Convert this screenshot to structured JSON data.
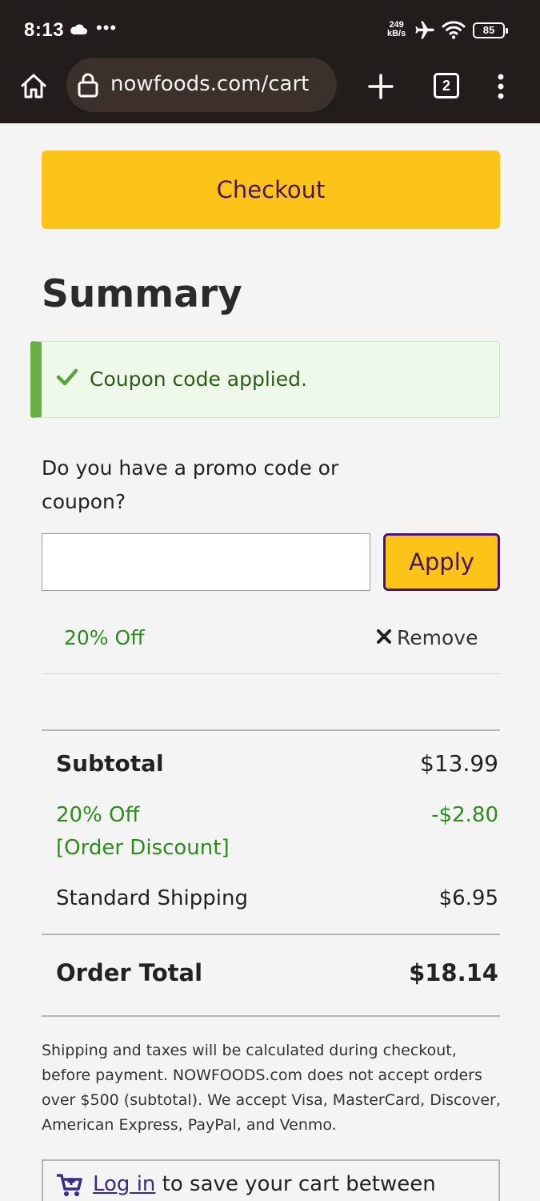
{
  "status_bar": {
    "time": "8:13",
    "dots": "•••",
    "speed_value": "249",
    "speed_unit": "kB/s",
    "battery": "85"
  },
  "browser": {
    "url": "nowfoods.com/cart",
    "tab_count": "2"
  },
  "checkout": {
    "label": "Checkout"
  },
  "summary": {
    "title": "Summary",
    "coupon_alert": "Coupon code applied.",
    "promo_question": "Do you have a promo code or coupon?",
    "promo_input_value": "",
    "apply_label": "Apply",
    "applied_coupon": "20% Off",
    "remove_label": "Remove"
  },
  "totals": {
    "subtotal_label": "Subtotal",
    "subtotal_value": "$13.99",
    "discount_label_1": "20% Off",
    "discount_label_2": "[Order Discount]",
    "discount_value": "-$2.80",
    "shipping_label": "Standard Shipping",
    "shipping_value": "$6.95",
    "order_total_label": "Order Total",
    "order_total_value": "$18.14"
  },
  "disclaimer": "Shipping and taxes will be calculated during checkout, before payment. NOWFOODS.com does not accept orders over $500 (subtotal). We accept Visa, MasterCard, Discover, American Express, PayPal, and Venmo.",
  "save_cart": {
    "login_label": "Log in",
    "text": " to save your cart between"
  },
  "colors": {
    "accent_yellow": "#fcc419",
    "brand_purple": "#4a1557",
    "success_green": "#2e8b1e",
    "browser_dark": "#221c1a"
  }
}
